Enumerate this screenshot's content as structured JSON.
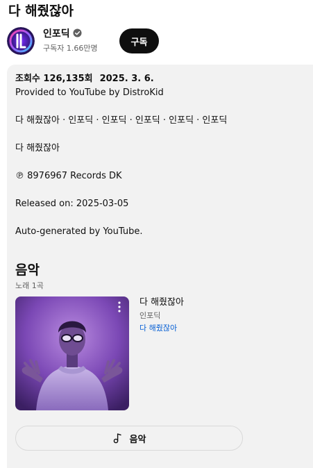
{
  "video": {
    "title": "다 해줬잖아"
  },
  "channel": {
    "name": "인포딕",
    "subscribers": "구독자 1.66만명",
    "subscribe_label": "구독"
  },
  "description": {
    "views": "조회수 126,135회",
    "date": "2025. 3. 6.",
    "lines": [
      "Provided to YouTube by DistroKid",
      "다 해줬잖아 · 인포딕 · 인포딕 · 인포딕 · 인포딕 · 인포딕",
      "다 해줬잖아",
      "℗ 8976967 Records DK",
      "Released on: 2025-03-05",
      "Auto-generated by YouTube."
    ]
  },
  "music": {
    "heading": "음악",
    "count": "노래 1곡",
    "song": {
      "title": "다 해줬잖아",
      "artist": "인포딕",
      "album": "다 해줬잖아"
    },
    "button_label": "음악"
  },
  "icons": {
    "verified": "verified-icon",
    "more": "more-vert-icon",
    "music_note": "music-note-icon"
  },
  "colors": {
    "link": "#065fd4",
    "panel": "#f2f2f2",
    "button": "#0f0f0f"
  }
}
